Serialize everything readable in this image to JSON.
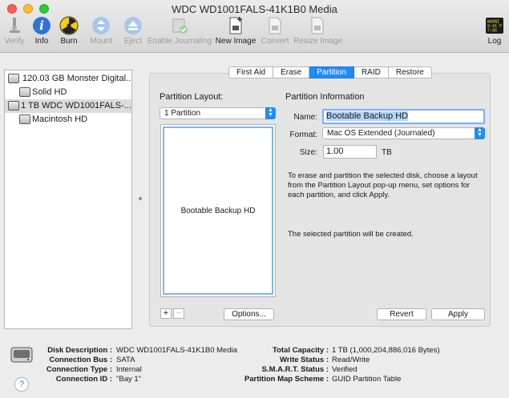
{
  "window": {
    "title": "WDC WD1001FALS-41K1B0 Media"
  },
  "toolbar": {
    "verify": "Verify",
    "info": "Info",
    "burn": "Burn",
    "mount": "Mount",
    "eject": "Eject",
    "enable_journaling": "Enable Journaling",
    "new_image": "New Image",
    "convert": "Convert",
    "resize_image": "Resize Image",
    "log": "Log",
    "log_icon_text": [
      "WARNI",
      "9:41 P",
      "7:86"
    ]
  },
  "sidebar": {
    "items": [
      {
        "label": "120.03 GB Monster Digital...",
        "icon": "disk-icon",
        "selected": false
      },
      {
        "label": "Solid HD",
        "icon": "volume-icon",
        "selected": false
      },
      {
        "label": "1 TB WDC WD1001FALS-...",
        "icon": "disk-icon",
        "selected": true
      },
      {
        "label": "Macintosh HD",
        "icon": "volume-icon",
        "selected": false
      }
    ]
  },
  "tabs": [
    "First Aid",
    "Erase",
    "Partition",
    "RAID",
    "Restore"
  ],
  "active_tab": "Partition",
  "partition": {
    "layout_heading": "Partition Layout:",
    "layout_select": "1 Partition",
    "partition_label": "Bootable Backup HD",
    "info_heading": "Partition Information",
    "name_label": "Name:",
    "name_value": "Bootable Backup HD",
    "format_label": "Format:",
    "format_value": "Mac OS Extended (Journaled)",
    "size_label": "Size:",
    "size_value": "1.00",
    "size_unit": "TB",
    "instructions": "To erase and partition the selected disk, choose a layout from the Partition Layout pop-up menu, set options for each partition, and click Apply.",
    "status": "The selected partition will be created.",
    "add_label": "+",
    "remove_label": "−",
    "options_label": "Options...",
    "revert_label": "Revert",
    "apply_label": "Apply"
  },
  "info": {
    "left": [
      {
        "key": "Disk Description :",
        "value": "WDC WD1001FALS-41K1B0 Media"
      },
      {
        "key": "Connection Bus :",
        "value": "SATA"
      },
      {
        "key": "Connection Type :",
        "value": "Internal"
      },
      {
        "key": "Connection ID :",
        "value": "\"Bay 1\""
      }
    ],
    "right": [
      {
        "key": "Total Capacity :",
        "value": "1 TB (1,000,204,886,016 Bytes)"
      },
      {
        "key": "Write Status :",
        "value": "Read/Write"
      },
      {
        "key": "S.M.A.R.T. Status :",
        "value": "Verified"
      },
      {
        "key": "Partition Map Scheme :",
        "value": "GUID Partition Table"
      }
    ],
    "help_label": "?"
  },
  "colors": {
    "accent": "#1f8cf7",
    "selection": "#dcdcdc"
  }
}
